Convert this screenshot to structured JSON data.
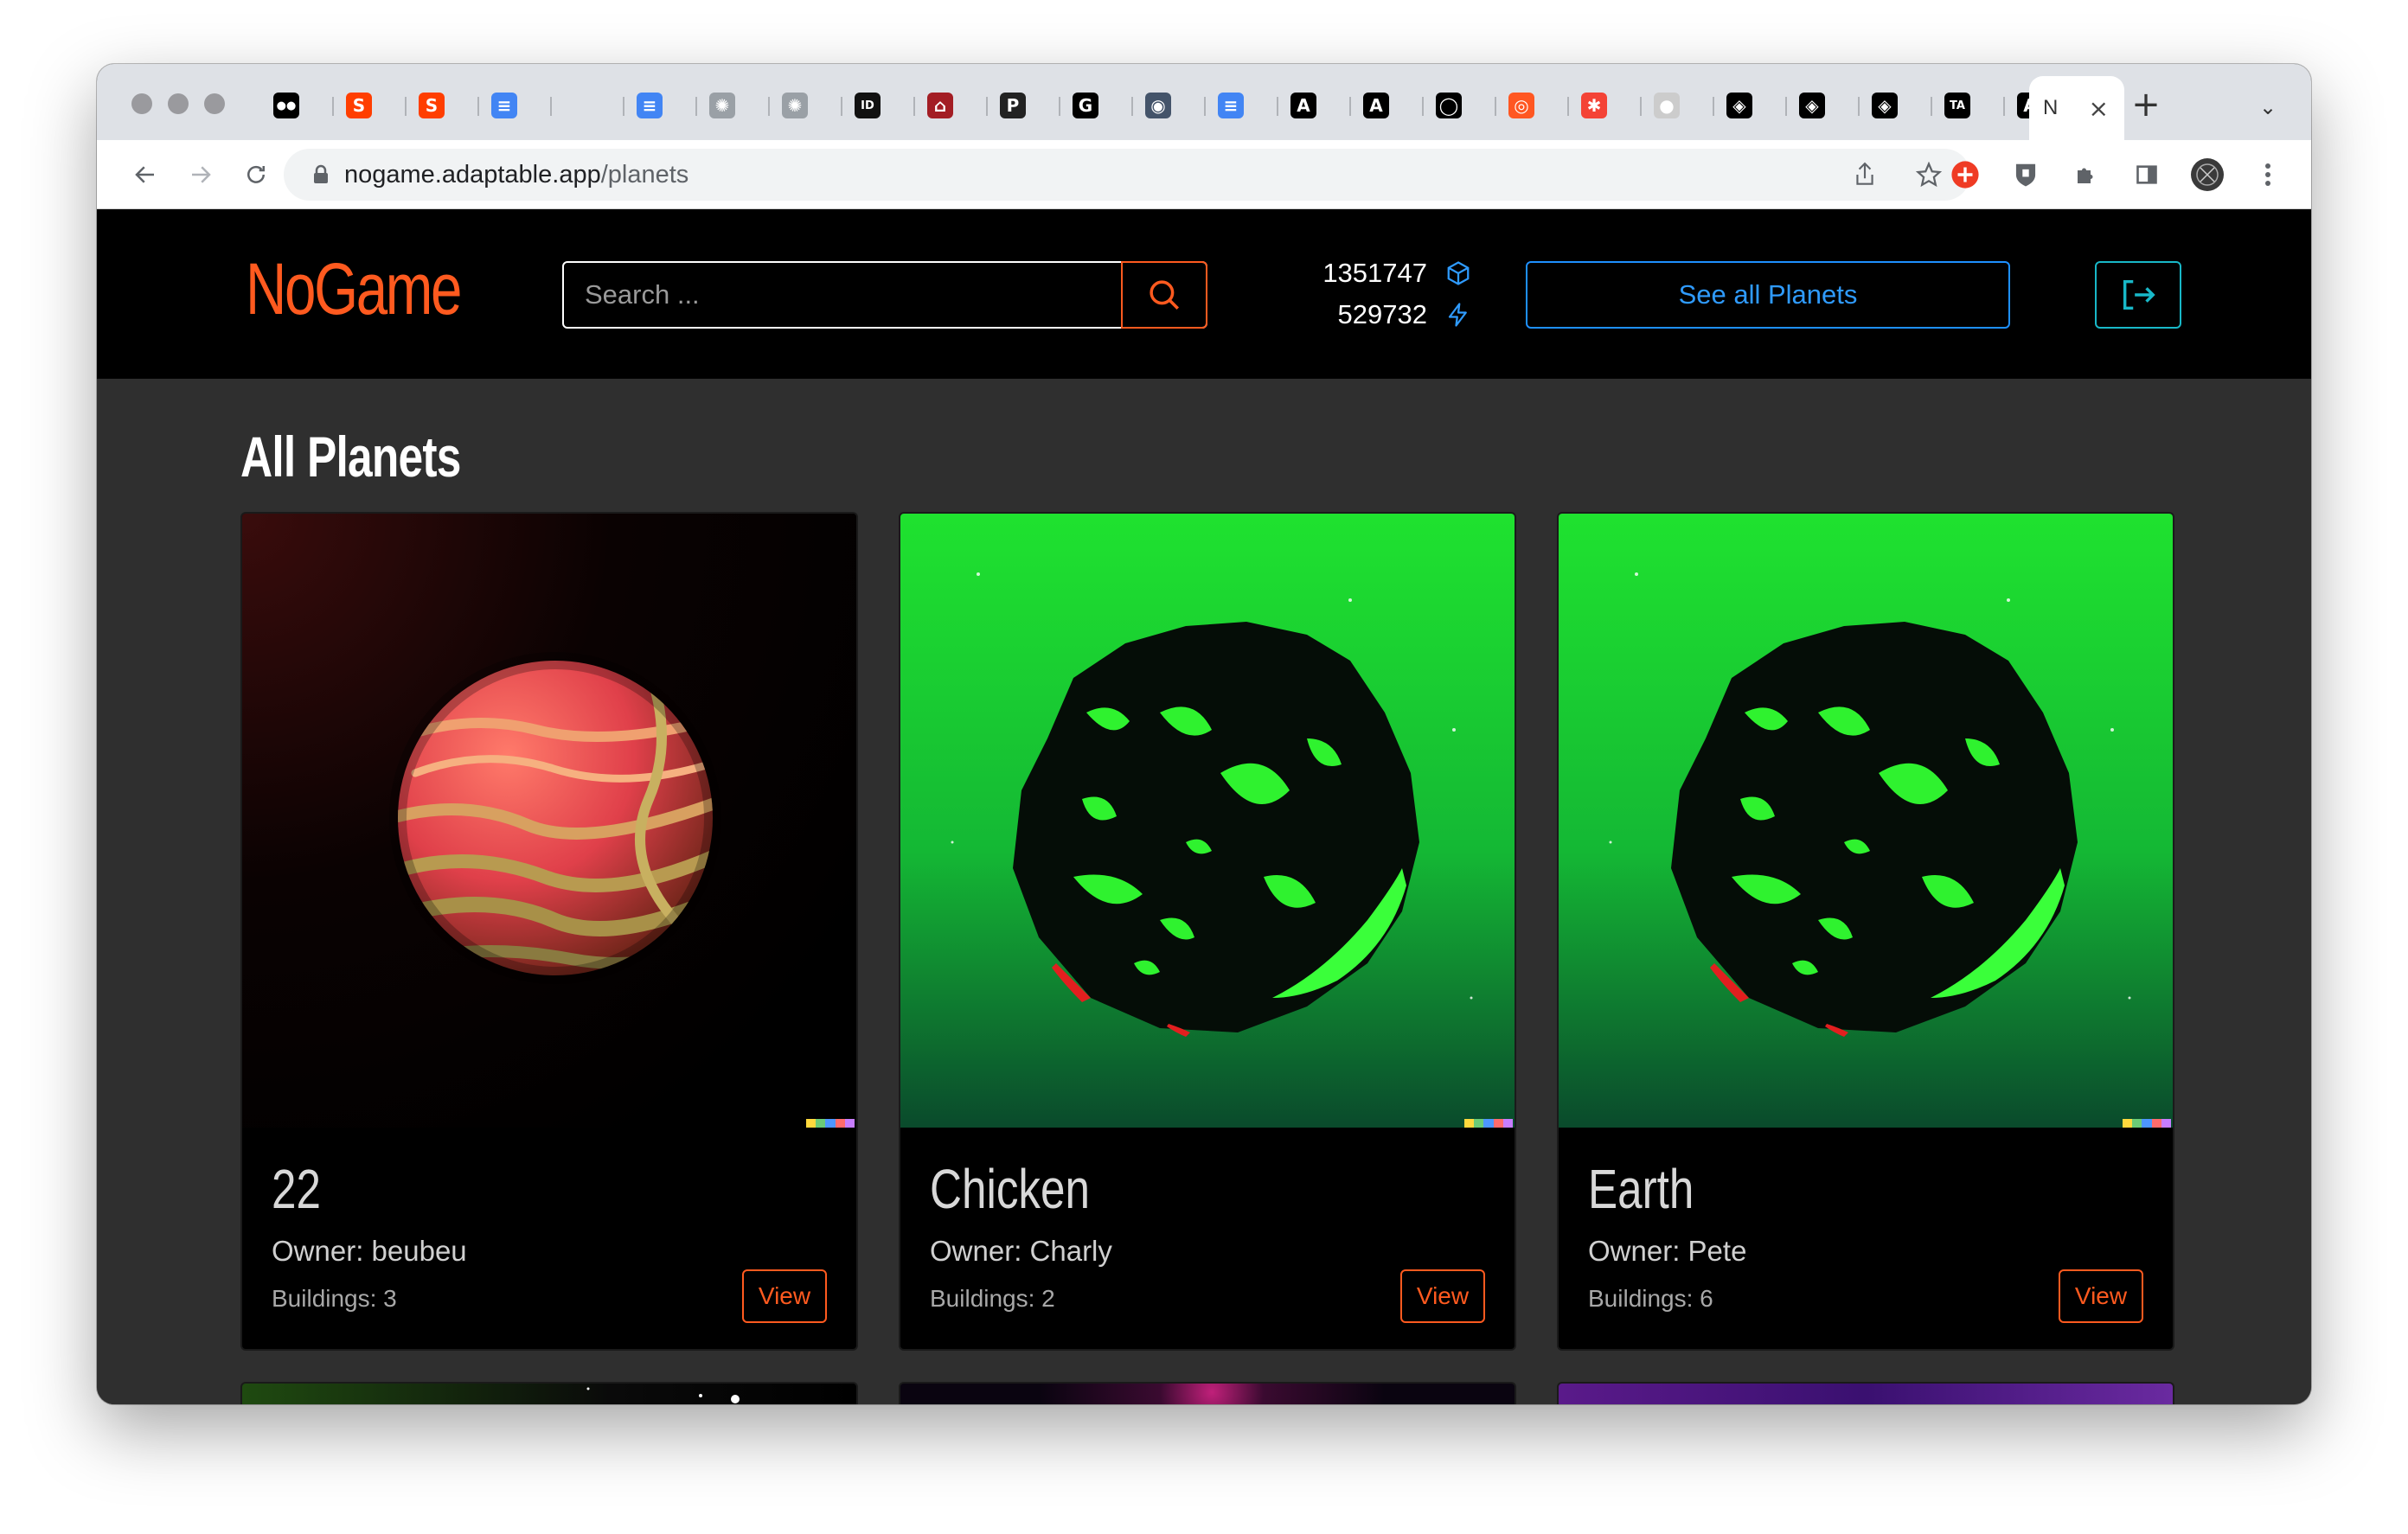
{
  "browser": {
    "active_tab_label": "N",
    "url_host": "nogame.adaptable.app",
    "url_path": "/planets",
    "tab_favicons": [
      {
        "icon": "medium-icon",
        "color": "#000000",
        "glyph": "●●"
      },
      {
        "icon": "svelte-icon",
        "color": "#ff3e00",
        "glyph": "S"
      },
      {
        "icon": "svelte-icon",
        "color": "#ff3e00",
        "glyph": "S"
      },
      {
        "icon": "google-docs-icon",
        "color": "#4285f4",
        "glyph": "≡"
      },
      {
        "icon": "blank-icon",
        "color": "#dee1e6",
        "glyph": ""
      },
      {
        "icon": "google-docs-icon",
        "color": "#4285f4",
        "glyph": "≡"
      },
      {
        "icon": "dots-icon",
        "color": "#9aa0a6",
        "glyph": "✺"
      },
      {
        "icon": "dots-icon",
        "color": "#9aa0a6",
        "glyph": "✺"
      },
      {
        "icon": "ideo-icon",
        "color": "#111111",
        "glyph": "ID"
      },
      {
        "icon": "museum-icon",
        "color": "#a31d24",
        "glyph": "⌂"
      },
      {
        "icon": "p-icon",
        "color": "#222222",
        "glyph": "P"
      },
      {
        "icon": "g-icon",
        "color": "#000000",
        "glyph": "G"
      },
      {
        "icon": "brain-icon",
        "color": "#44546a",
        "glyph": "◉"
      },
      {
        "icon": "google-docs-icon",
        "color": "#4285f4",
        "glyph": "≡"
      },
      {
        "icon": "astro-icon",
        "color": "#000000",
        "glyph": "A"
      },
      {
        "icon": "astro-icon",
        "color": "#000000",
        "glyph": "A"
      },
      {
        "icon": "github-icon",
        "color": "#000000",
        "glyph": "◯"
      },
      {
        "icon": "ring-icon",
        "color": "#ff5722",
        "glyph": "◎"
      },
      {
        "icon": "asterisk-icon",
        "color": "#f44336",
        "glyph": "✱"
      },
      {
        "icon": "sphere-icon",
        "color": "#cccccc",
        "glyph": "●"
      },
      {
        "icon": "codepen-icon",
        "color": "#000000",
        "glyph": "◈"
      },
      {
        "icon": "codepen-icon",
        "color": "#000000",
        "glyph": "◈"
      },
      {
        "icon": "codepen-icon",
        "color": "#000000",
        "glyph": "◈"
      },
      {
        "icon": "ta-icon",
        "color": "#000000",
        "glyph": "TA"
      },
      {
        "icon": "astro-icon",
        "color": "#000000",
        "glyph": "A"
      }
    ]
  },
  "app": {
    "logo": "NoGame",
    "search_placeholder": "Search ...",
    "resource_1": "1351747",
    "resource_2": "529732",
    "see_all_label": "See all Planets",
    "page_title": "All Planets",
    "accent_color": "#ff5a1f",
    "link_color": "#1e90ff"
  },
  "planets": [
    {
      "name": "22",
      "owner": "Owner: beubeu",
      "buildings": "Buildings: 3",
      "view_label": "View",
      "style": "gas-giant-red"
    },
    {
      "name": "Chicken",
      "owner": "Owner: Charly",
      "buildings": "Buildings: 2",
      "view_label": "View",
      "style": "green-rock"
    },
    {
      "name": "Earth",
      "owner": "Owner: Pete",
      "buildings": "Buildings: 6",
      "view_label": "View",
      "style": "green-rock"
    }
  ]
}
